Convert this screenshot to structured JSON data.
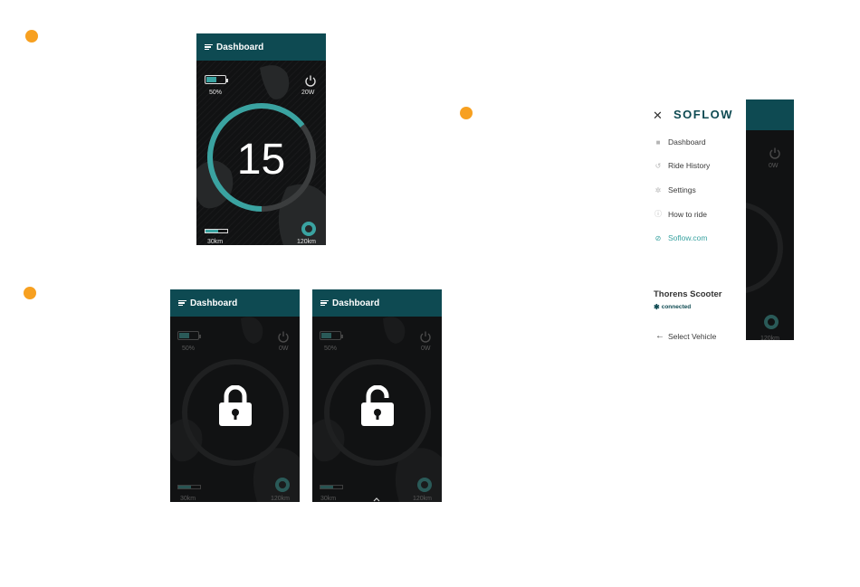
{
  "colors": {
    "accent": "#3aa3a1",
    "header": "#0e4a52",
    "marker": "#f7a020",
    "screen": "#111213"
  },
  "icons": [
    "menu-icon",
    "power-icon",
    "scooter-icon",
    "lock-icon",
    "unlock-icon",
    "close-icon",
    "home-icon",
    "history-icon",
    "gear-icon",
    "info-icon",
    "link-icon",
    "bluetooth-icon",
    "arrow-left-icon",
    "chevron-up-icon"
  ],
  "screen_main": {
    "header_title": "Dashboard",
    "battery": "50%",
    "battery_level": 0.5,
    "power": "20W",
    "speed": "15",
    "speed_arc_fraction": 0.5,
    "range_left": "30km",
    "range_level": 0.55,
    "range_right": "120km"
  },
  "screen_locked": {
    "header_title": "Dashboard",
    "battery": "50%",
    "power": "0W",
    "range_left": "30km",
    "range_right": "120km"
  },
  "screen_unlocked": {
    "header_title": "Dashboard",
    "battery": "50%",
    "power": "0W",
    "range_left": "30km",
    "range_right": "120km"
  },
  "side_menu": {
    "logo": "SOFLOW",
    "items": [
      {
        "label": "Dashboard",
        "icon": "home-icon"
      },
      {
        "label": "Ride History",
        "icon": "history-icon"
      },
      {
        "label": "Settings",
        "icon": "gear-icon"
      },
      {
        "label": "How to ride",
        "icon": "info-icon"
      },
      {
        "label": "Soflow.com",
        "icon": "link-icon"
      }
    ],
    "vehicle_name": "Thorens Scooter",
    "status": "connected",
    "select_vehicle": "Select Vehicle",
    "peek_power": "0W",
    "peek_range": "120km"
  }
}
